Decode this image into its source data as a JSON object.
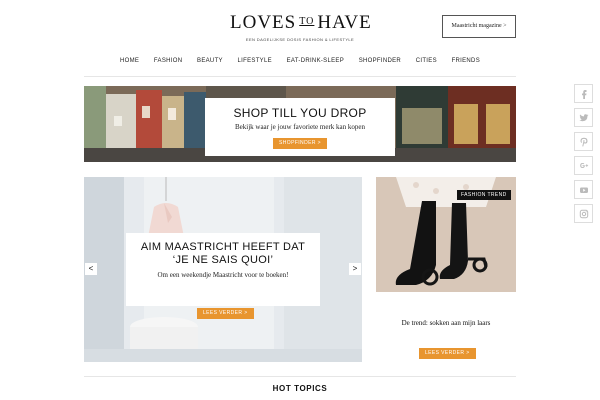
{
  "header": {
    "logo_left": "LOVES",
    "logo_mid": "TO",
    "logo_right": "HAVE",
    "tagline": "EEN DAGELIJKSE DOSIS FASHION & LIFESTYLE",
    "magazine_button": "Maastricht magazine >"
  },
  "nav": {
    "items": [
      {
        "label": "HOME"
      },
      {
        "label": "FASHION"
      },
      {
        "label": "BEAUTY"
      },
      {
        "label": "LIFESTYLE"
      },
      {
        "label": "EAT-DRINK-SLEEP"
      },
      {
        "label": "SHOPFINDER"
      },
      {
        "label": "CITIES"
      },
      {
        "label": "FRIENDS"
      }
    ]
  },
  "banner": {
    "title": "SHOP TILL YOU DROP",
    "subtitle": "Bekijk waar je jouw favoriete merk kan kopen",
    "button": "SHOPFINDER >"
  },
  "slider": {
    "title": "AIM MAASTRICHT HEEFT DAT ‘JE NE SAIS QUOI’",
    "subtitle": "Om een weekendje Maastricht voor te boeken!",
    "button": "LEES VERDER >",
    "prev": "<",
    "next": ">"
  },
  "trend": {
    "badge": "FASHION TREND",
    "title": "De trend: sokken aan mijn laars",
    "button": "LEES VERDER >"
  },
  "hot_topics": {
    "title": "HOT TOPICS"
  },
  "social": {
    "icons": [
      "facebook-icon",
      "twitter-icon",
      "pinterest-icon",
      "google-plus-icon",
      "youtube-icon",
      "instagram-icon"
    ]
  },
  "colors": {
    "accent": "#e8952f",
    "badge": "#111111",
    "text": "#222222"
  }
}
